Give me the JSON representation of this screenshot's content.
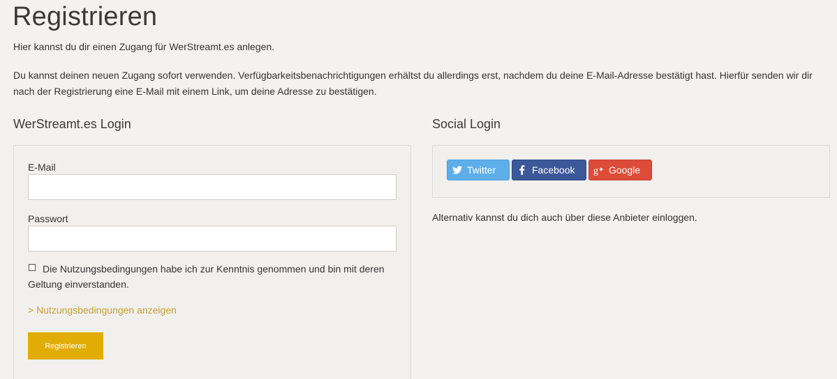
{
  "page": {
    "title": "Registrieren",
    "intro": "Hier kannst du dir einen Zugang für WerStreamt.es anlegen.",
    "info": "Du kannst deinen neuen Zugang sofort verwenden. Verfügbarkeitsbenachrichtigungen erhältst du allerdings erst, nachdem du deine E-Mail-Adresse bestätigt hast. Hierfür senden wir dir nach der Registrierung eine E-Mail mit einem Link, um deine Adresse zu bestätigen."
  },
  "login": {
    "heading": "WerStreamt.es Login",
    "email_label": "E-Mail",
    "email_value": "",
    "password_label": "Passwort",
    "password_value": "",
    "terms_checked": false,
    "terms_text": "Die Nutzungsbedingungen habe ich zur Kenntnis genommen und bin mit deren Geltung einverstanden.",
    "terms_link": "> Nutzungsbedingungen anzeigen",
    "submit_label": "Registrieren",
    "accent_color": "#e2ac06"
  },
  "social": {
    "heading": "Social Login",
    "buttons": [
      {
        "label": "Twitter",
        "icon": "twitter-bird-icon",
        "color": "#5eaeea"
      },
      {
        "label": "Facebook",
        "icon": "facebook-f-icon",
        "color": "#3b5998"
      },
      {
        "label": "Google",
        "icon": "google-plus-icon",
        "color": "#dd4b39"
      }
    ],
    "alternative_text": "Alternativ kannst du dich auch über diese Anbieter einloggen."
  }
}
